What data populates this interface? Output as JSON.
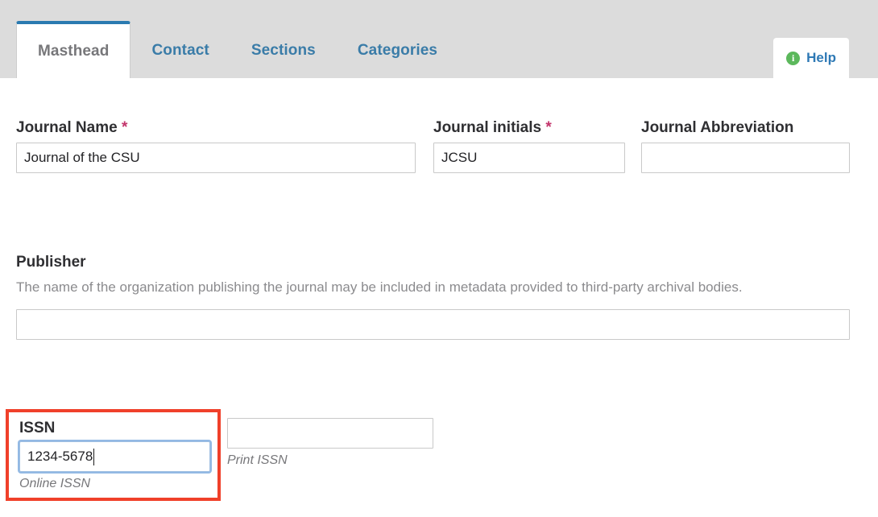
{
  "tabs": [
    {
      "label": "Masthead",
      "active": true
    },
    {
      "label": "Contact",
      "active": false
    },
    {
      "label": "Sections",
      "active": false
    },
    {
      "label": "Categories",
      "active": false
    }
  ],
  "help": {
    "label": "Help",
    "icon": "info-circle-icon",
    "icon_glyph": "i",
    "icon_color": "#5cb85c",
    "label_color": "#2e79b5"
  },
  "form": {
    "journal_name": {
      "label": "Journal Name",
      "required_marker": "*",
      "value": "Journal of the CSU",
      "placeholder": ""
    },
    "journal_initials": {
      "label": "Journal initials",
      "required_marker": "*",
      "value": "JCSU",
      "placeholder": ""
    },
    "journal_abbreviation": {
      "label": "Journal Abbreviation",
      "required_marker": "",
      "value": "",
      "placeholder": ""
    },
    "publisher": {
      "title": "Publisher",
      "description": "The name of the organization publishing the journal may be included in metadata provided to third-party archival bodies.",
      "value": "",
      "placeholder": ""
    },
    "issn": {
      "title": "ISSN",
      "online": {
        "value": "1234-5678",
        "hint": "Online ISSN",
        "focused": true,
        "caret_after_text": true
      },
      "print": {
        "value": "",
        "placeholder": "",
        "hint": "Print ISSN"
      }
    }
  },
  "colors": {
    "tabbar_bg": "#dcdcdc",
    "tab_link": "#3a7ca8",
    "tab_active_text": "#77777a",
    "tab_active_top_border": "#2a7ab0",
    "required_asterisk": "#c3346b",
    "annotation_red": "#f0402a",
    "focus_blue": "#93b9e4",
    "input_border": "#c9c9c9",
    "muted_text": "#8b8b8e"
  }
}
